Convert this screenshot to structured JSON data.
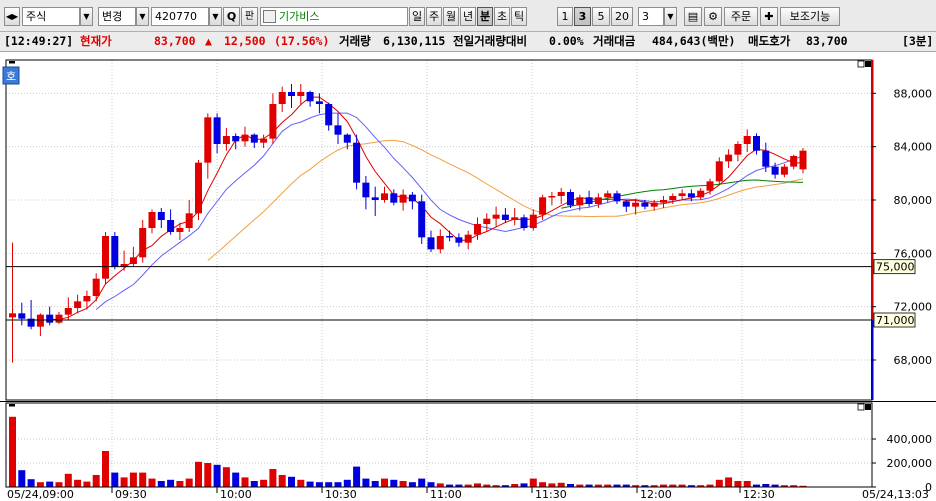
{
  "toolbar": {
    "market_select": "주식",
    "type_select": "변경",
    "code": "420770",
    "search_btn": "Q",
    "lock_btn": "판",
    "name": "기가비스",
    "periods": [
      {
        "label": "일",
        "selected": false
      },
      {
        "label": "주",
        "selected": false
      },
      {
        "label": "월",
        "selected": false
      },
      {
        "label": "년",
        "selected": false
      },
      {
        "label": "분",
        "selected": true
      },
      {
        "label": "초",
        "selected": false
      },
      {
        "label": "틱",
        "selected": false
      }
    ],
    "intervals": [
      {
        "label": "1",
        "selected": false
      },
      {
        "label": "3",
        "selected": true
      },
      {
        "label": "5",
        "selected": false
      },
      {
        "label": "20",
        "selected": false
      }
    ],
    "interval_value": "3",
    "order_btn": "주문",
    "aux_btn": "보조기능"
  },
  "infobar": {
    "time": "[12:49:27]",
    "price_label": "현재가",
    "price": "83,700",
    "change_arrow": "▲",
    "change": "12,500",
    "change_pct": "(17.56%)",
    "volume_label": "거래량",
    "volume": "6,130,115",
    "prev_vol_label": "전일거래량대비",
    "prev_vol": "0.00%",
    "amount_label": "거래대금",
    "amount": "484,643(백만)",
    "ask_label": "매도호가",
    "ask": "83,700",
    "period": "[3분]"
  },
  "chart_data": {
    "type": "candlestick",
    "price_axis": {
      "ylim": [
        65000,
        90500
      ],
      "ticks": [
        "88,000",
        "84,000",
        "80,000",
        "76,000",
        "72,000",
        "68,000"
      ]
    },
    "volume_axis": {
      "ylim": [
        0,
        700000
      ],
      "ticks": [
        "400,000",
        "200,000",
        "0"
      ]
    },
    "x_labels": [
      "05/24,09:00",
      "09:30",
      "10:00",
      "10:30",
      "11:00",
      "11:30",
      "12:00",
      "12:30",
      "05/24,13:03"
    ],
    "hlines": [
      {
        "value": "75,000"
      },
      {
        "value": "71,000"
      }
    ],
    "mode_tag": "호",
    "colors": {
      "up": "#e00000",
      "down": "#0000e0",
      "ma5": "#e00000",
      "ma10": "#6060ff",
      "ma20": "#f0a040",
      "ma60": "#008000"
    },
    "candles": [
      [
        71200,
        76800,
        67800,
        71500
      ],
      [
        71500,
        72300,
        70600,
        71100
      ],
      [
        71100,
        72500,
        70300,
        70500
      ],
      [
        70500,
        71500,
        69800,
        71400
      ],
      [
        71400,
        72000,
        70600,
        70800
      ],
      [
        70800,
        71600,
        70700,
        71400
      ],
      [
        71400,
        72700,
        71000,
        71900
      ],
      [
        71900,
        72900,
        71500,
        72400
      ],
      [
        72400,
        73200,
        71800,
        72800
      ],
      [
        72800,
        74500,
        72400,
        74100
      ],
      [
        74100,
        77600,
        73700,
        77300
      ],
      [
        77300,
        77600,
        74800,
        75000
      ],
      [
        75000,
        76200,
        74700,
        75200
      ],
      [
        75200,
        76500,
        75000,
        75700
      ],
      [
        75700,
        78500,
        75300,
        77900
      ],
      [
        77900,
        79300,
        77500,
        79100
      ],
      [
        79100,
        79400,
        77900,
        78500
      ],
      [
        78500,
        79300,
        77400,
        77600
      ],
      [
        77600,
        78300,
        77000,
        77900
      ],
      [
        77900,
        80000,
        77600,
        79000
      ],
      [
        79000,
        83000,
        78500,
        82800
      ],
      [
        82800,
        86500,
        81600,
        86200
      ],
      [
        86200,
        86500,
        83500,
        84200
      ],
      [
        84200,
        85400,
        83700,
        84800
      ],
      [
        84800,
        85000,
        83800,
        84400
      ],
      [
        84400,
        85500,
        84000,
        84900
      ],
      [
        84900,
        85000,
        83900,
        84300
      ],
      [
        84300,
        84900,
        83900,
        84600
      ],
      [
        84600,
        88000,
        84200,
        87200
      ],
      [
        87200,
        88500,
        86600,
        88100
      ],
      [
        88100,
        88700,
        86900,
        87800
      ],
      [
        87800,
        88700,
        87100,
        88100
      ],
      [
        88100,
        88200,
        87000,
        87400
      ],
      [
        87400,
        88000,
        86500,
        87200
      ],
      [
        87200,
        87300,
        85200,
        85600
      ],
      [
        85600,
        86500,
        84200,
        84900
      ],
      [
        84900,
        85000,
        83800,
        84300
      ],
      [
        84300,
        84900,
        80800,
        81300
      ],
      [
        81300,
        81800,
        79300,
        80200
      ],
      [
        80200,
        81000,
        78800,
        80000
      ],
      [
        80000,
        81000,
        79800,
        80500
      ],
      [
        80500,
        80800,
        79600,
        79800
      ],
      [
        79800,
        80800,
        79200,
        80400
      ],
      [
        80400,
        80600,
        79300,
        79900
      ],
      [
        79900,
        80400,
        76700,
        77200
      ],
      [
        77200,
        77700,
        76100,
        76300
      ],
      [
        76300,
        77800,
        76000,
        77300
      ],
      [
        77300,
        77700,
        76900,
        77200
      ],
      [
        77200,
        77500,
        76500,
        76800
      ],
      [
        76800,
        77700,
        76300,
        77400
      ],
      [
        77400,
        78700,
        77000,
        78200
      ],
      [
        78200,
        79000,
        77600,
        78600
      ],
      [
        78600,
        79500,
        78000,
        78900
      ],
      [
        78900,
        79400,
        78300,
        78500
      ],
      [
        78500,
        79400,
        78100,
        78700
      ],
      [
        78700,
        78900,
        77700,
        77900
      ],
      [
        77900,
        79300,
        77700,
        78900
      ],
      [
        78900,
        80400,
        78500,
        80200
      ],
      [
        80200,
        80600,
        79600,
        80300
      ],
      [
        80300,
        80900,
        79700,
        80600
      ],
      [
        80600,
        80800,
        79400,
        79600
      ],
      [
        79600,
        80400,
        79200,
        80200
      ],
      [
        80200,
        80700,
        79500,
        79700
      ],
      [
        79700,
        80500,
        79400,
        80200
      ],
      [
        80200,
        80700,
        79800,
        80500
      ],
      [
        80500,
        80700,
        79700,
        79900
      ],
      [
        79900,
        80000,
        79100,
        79500
      ],
      [
        79500,
        80100,
        78900,
        79800
      ],
      [
        79800,
        80000,
        79300,
        79500
      ],
      [
        79500,
        80000,
        79200,
        79800
      ],
      [
        79800,
        80300,
        79400,
        80000
      ],
      [
        80000,
        80500,
        79700,
        80300
      ],
      [
        80300,
        80800,
        80000,
        80500
      ],
      [
        80500,
        80800,
        79900,
        80200
      ],
      [
        80200,
        80900,
        80000,
        80700
      ],
      [
        80700,
        81600,
        80400,
        81400
      ],
      [
        81400,
        83200,
        81100,
        82900
      ],
      [
        82900,
        83800,
        82400,
        83400
      ],
      [
        83400,
        84400,
        82900,
        84200
      ],
      [
        84200,
        85300,
        83600,
        84800
      ],
      [
        84800,
        85000,
        83400,
        83700
      ],
      [
        83700,
        84300,
        82100,
        82500
      ],
      [
        82500,
        82800,
        81600,
        81900
      ],
      [
        81900,
        82700,
        81700,
        82500
      ],
      [
        82500,
        83400,
        82300,
        83300
      ],
      [
        82300,
        83900,
        82000,
        83700
      ]
    ],
    "volumes": [
      585000,
      140000,
      65000,
      40000,
      45000,
      40000,
      110000,
      60000,
      45000,
      100000,
      300000,
      120000,
      80000,
      120000,
      120000,
      70000,
      50000,
      60000,
      50000,
      70000,
      210000,
      200000,
      185000,
      165000,
      120000,
      80000,
      50000,
      60000,
      150000,
      100000,
      85000,
      60000,
      45000,
      40000,
      40000,
      40000,
      60000,
      170000,
      70000,
      50000,
      70000,
      60000,
      50000,
      40000,
      70000,
      40000,
      30000,
      20000,
      20000,
      20000,
      30000,
      20000,
      15000,
      15000,
      25000,
      30000,
      70000,
      40000,
      30000,
      35000,
      25000,
      20000,
      20000,
      20000,
      20000,
      20000,
      20000,
      15000,
      15000,
      15000,
      20000,
      20000,
      20000,
      15000,
      15000,
      20000,
      60000,
      80000,
      50000,
      50000,
      20000,
      25000,
      20000,
      15000,
      15000,
      10000
    ]
  }
}
